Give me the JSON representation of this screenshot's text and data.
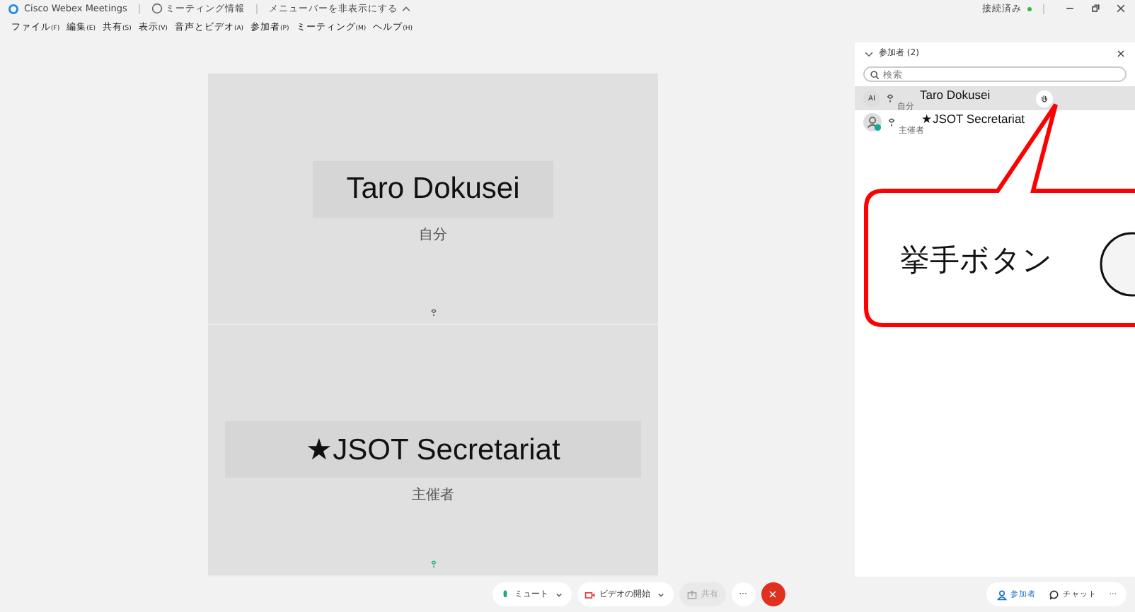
{
  "title_bar": {
    "app_name": "Cisco Webex Meetings",
    "meeting_info": "ミーティング情報",
    "hide_menu": "メニューバーを非表示にする",
    "status": "接続済み"
  },
  "menu": [
    {
      "label": "ファイル",
      "key": "(F)"
    },
    {
      "label": "編集",
      "key": "(E)"
    },
    {
      "label": "共有",
      "key": "(S)"
    },
    {
      "label": "表示",
      "key": "(V)"
    },
    {
      "label": "音声とビデオ",
      "key": "(A)"
    },
    {
      "label": "参加者",
      "key": "(P)"
    },
    {
      "label": "ミーティング",
      "key": "(M)"
    },
    {
      "label": "ヘルプ",
      "key": "(H)"
    }
  ],
  "tiles": [
    {
      "name": "Taro Dokusei",
      "role": "自分"
    },
    {
      "name": "★JSOT Secretariat",
      "role": "主催者"
    }
  ],
  "participants_panel": {
    "title": "参加者 (2)",
    "search_placeholder": "検索",
    "participants": [
      {
        "avatar": "AI",
        "name": "Taro Dokusei",
        "role": "自分",
        "selected": true,
        "hand_button": true
      },
      {
        "name": "★JSOT Secretariat",
        "role": "主催者",
        "selected": false,
        "hand_button": false
      }
    ]
  },
  "controls": [
    {
      "kind": "mute",
      "label": "ミュート",
      "disabled": false
    },
    {
      "kind": "video",
      "label": "ビデオの開始",
      "disabled": false
    },
    {
      "kind": "share",
      "label": "共有",
      "disabled": true
    },
    {
      "kind": "more",
      "label": "···",
      "disabled": false
    },
    {
      "kind": "end",
      "label": "×",
      "disabled": false
    }
  ],
  "panel_buttons": [
    {
      "kind": "participants",
      "label": "参加者",
      "selected": true
    },
    {
      "kind": "chat",
      "label": "チャット",
      "selected": false
    },
    {
      "kind": "more",
      "label": "···",
      "selected": false
    }
  ],
  "callout": {
    "text": "挙手ボタン"
  }
}
